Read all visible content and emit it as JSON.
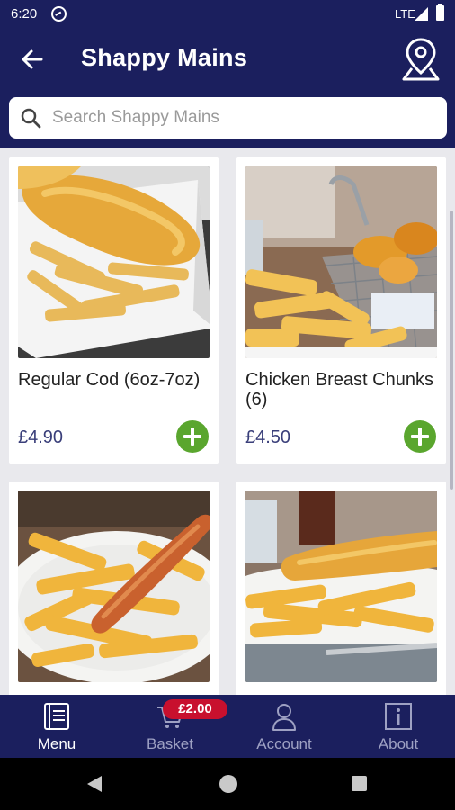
{
  "status_bar": {
    "time": "6:20",
    "network": "LTE"
  },
  "header": {
    "title": "Shappy Mains"
  },
  "search": {
    "placeholder": "Search Shappy Mains",
    "value": ""
  },
  "items": [
    {
      "name": "Regular Cod (6oz-7oz)",
      "price": "£4.90",
      "image": "cod-and-chips"
    },
    {
      "name": "Chicken Breast Chunks (6)",
      "price": "£4.50",
      "image": "chicken-chunks-basket"
    },
    {
      "name": "",
      "price": "",
      "image": "sausage-and-chips"
    },
    {
      "name": "",
      "price": "",
      "image": "battered-sausage-and-chips"
    }
  ],
  "bottom_nav": {
    "items": [
      {
        "label": "Menu",
        "icon": "menu-book-icon",
        "active": true
      },
      {
        "label": "Basket",
        "icon": "basket-icon",
        "active": false
      },
      {
        "label": "Account",
        "icon": "person-icon",
        "active": false
      },
      {
        "label": "About",
        "icon": "info-icon",
        "active": false
      }
    ],
    "basket_total": "£2.00"
  },
  "colors": {
    "primary": "#1b1f5e",
    "accent_green": "#5aa62e",
    "badge_red": "#c8102e",
    "background": "#e9e9ed"
  }
}
